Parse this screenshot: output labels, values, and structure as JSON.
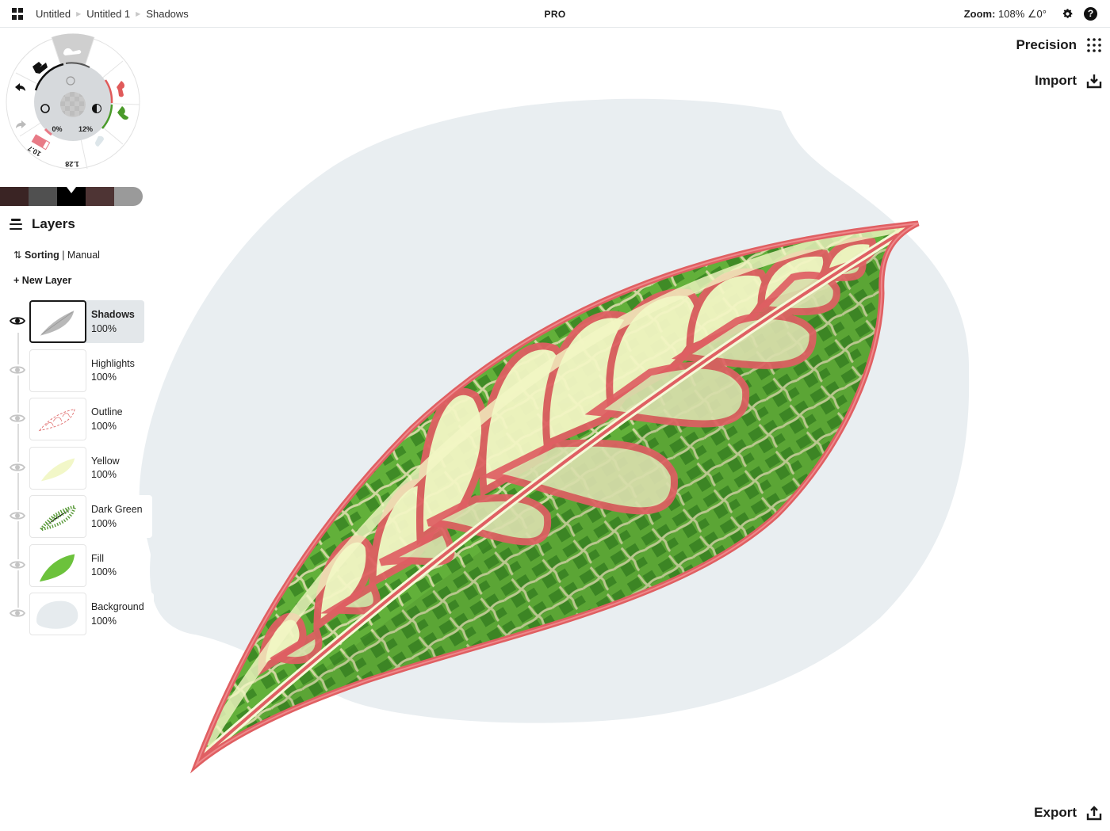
{
  "topbar": {
    "breadcrumb": [
      "Untitled",
      "Untitled 1",
      "Shadows"
    ],
    "center_label": "PRO",
    "zoom_label": "Zoom:",
    "zoom_value": "108%",
    "rotation_value": "∠0°"
  },
  "right_actions": {
    "precision": "Precision",
    "import": "Import",
    "export": "Export"
  },
  "tool_wheel": {
    "opacity_value": "0%",
    "smoothing_value": "12%",
    "size_value": "10.7",
    "weight_value": "1.28",
    "tools": [
      "pencil",
      "eraser",
      "red-brush",
      "green-brush",
      "light-brush",
      "undo",
      "redo"
    ],
    "tool_colors": {
      "pencil": "#111111",
      "eraser": "#ffffff",
      "red_brush": "#e05a5a",
      "green_brush": "#4a9a2a",
      "light_brush": "#dde6ea",
      "size_swatch": "#e87a86"
    }
  },
  "color_swatches": [
    {
      "hex": "#3a2424",
      "active": false
    },
    {
      "hex": "#505050",
      "active": false
    },
    {
      "hex": "#000000",
      "active": true
    },
    {
      "hex": "#4e3434",
      "active": false
    },
    {
      "hex": "#9a9a9a",
      "active": false
    }
  ],
  "layers_panel": {
    "title": "Layers",
    "sorting_label": "Sorting",
    "sorting_value": "Manual",
    "new_layer_label": "New Layer",
    "layers": [
      {
        "name": "Shadows",
        "opacity": "100%",
        "selected": true,
        "visible": true
      },
      {
        "name": "Highlights",
        "opacity": "100%",
        "selected": false,
        "visible": true
      },
      {
        "name": "Outline",
        "opacity": "100%",
        "selected": false,
        "visible": true
      },
      {
        "name": "Yellow",
        "opacity": "100%",
        "selected": false,
        "visible": true
      },
      {
        "name": "Dark Green",
        "opacity": "100%",
        "selected": false,
        "visible": true
      },
      {
        "name": "Fill",
        "opacity": "100%",
        "selected": false,
        "visible": true
      },
      {
        "name": "Background",
        "opacity": "100%",
        "selected": false,
        "visible": true
      }
    ]
  },
  "artwork": {
    "background_blob": "#e9eef1",
    "leaf_fill": "#5aa832",
    "leaf_dark": "#3e8a24",
    "leaf_outline": "#e05f62",
    "vein_yellow": "#f3f6c4",
    "vein_pale": "#d6dca8"
  }
}
